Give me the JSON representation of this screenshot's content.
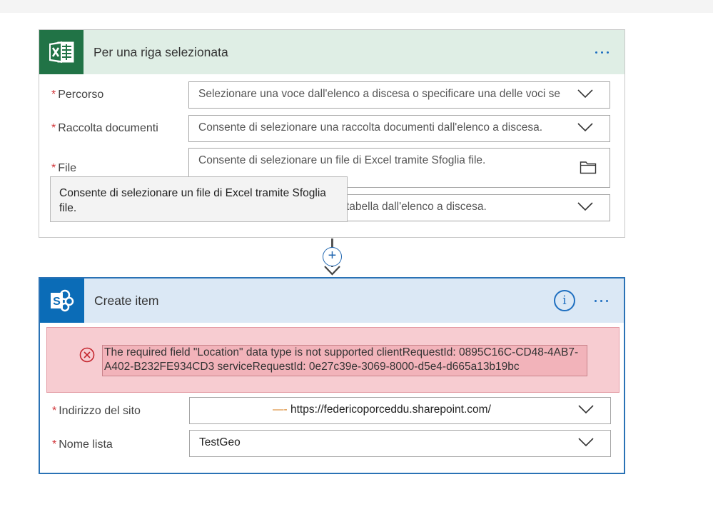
{
  "excel_card": {
    "title": "Per una riga selezionata",
    "fields": [
      {
        "label": "Percorso",
        "value": "Selezionare una voce dall'elenco a discesa o specificare una delle voci se"
      },
      {
        "label": "Raccolta documenti",
        "value": "Consente di selezionare una raccolta documenti dall'elenco a discesa."
      },
      {
        "label": "File",
        "value": "Consente di selezionare un file di Excel tramite Sfoglia file."
      },
      {
        "label": "",
        "value": "tabella dall'elenco a discesa."
      }
    ],
    "required_marker": "*",
    "tooltip": "Consente di selezionare un file di Excel tramite Sfoglia file."
  },
  "connector": {
    "add_symbol": "+"
  },
  "sharepoint_card": {
    "title": "Create item",
    "info_symbol": "i",
    "error": "The required field \"Location\" data type is not supported clientRequestId: 0895C16C-CD48-4AB7-A402-B232FE934CD3 serviceRequestId: 0e27c39e-3069-8000-d5e4-d665a13b19bc",
    "fields": [
      {
        "label": "Indirizzo del sito",
        "prefix": "—-",
        "value": "https://federicoporceddu.sharepoint.com/"
      },
      {
        "label": "Nome lista",
        "value": "TestGeo"
      }
    ]
  },
  "colors": {
    "excel_brand": "#217346",
    "sharepoint_brand": "#0b6cb7",
    "accent": "#1f6fc0",
    "required": "#d13438",
    "error_bg": "#f7ccd1"
  },
  "icons": [
    "excel-icon",
    "sharepoint-icon",
    "more-options-icon",
    "info-icon",
    "chevron-down-icon",
    "folder-icon",
    "add-step-icon",
    "arrow-down-icon",
    "error-icon"
  ]
}
